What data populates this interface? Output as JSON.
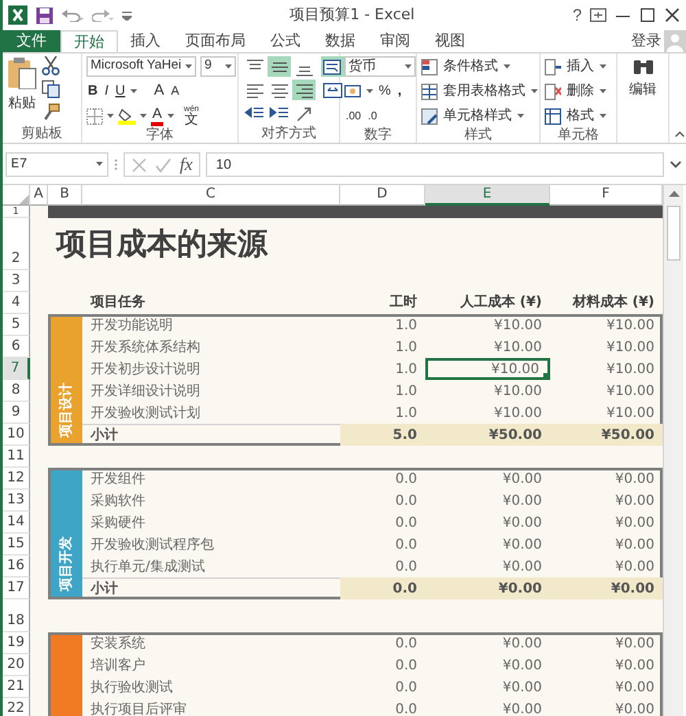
{
  "window": {
    "title": "项目预算1 - Excel",
    "help": "?"
  },
  "ribbon_tabs": [
    {
      "label": "文件",
      "kind": "file",
      "selected": false
    },
    {
      "label": "开始",
      "kind": "tab",
      "selected": true
    },
    {
      "label": "插入",
      "kind": "tab",
      "selected": false
    },
    {
      "label": "页面布局",
      "kind": "tab",
      "selected": false
    },
    {
      "label": "公式",
      "kind": "tab",
      "selected": false
    },
    {
      "label": "数据",
      "kind": "tab",
      "selected": false
    },
    {
      "label": "审阅",
      "kind": "tab",
      "selected": false
    },
    {
      "label": "视图",
      "kind": "tab",
      "selected": false
    }
  ],
  "account": "登录",
  "ribbon": {
    "clipboard": {
      "label": "剪贴板",
      "paste": "粘贴"
    },
    "font": {
      "label": "字体",
      "font_name": "Microsoft YaHei",
      "font_size": "9",
      "bold": "B",
      "italic": "I",
      "underline": "U",
      "grow": "A",
      "shrink": "A",
      "font_color": "A",
      "phonetic": "wén",
      "phonetic_char": "文"
    },
    "alignment": {
      "label": "对齐方式",
      "rows": [
        [
          {
            "kind": "top",
            "selected": false
          },
          {
            "kind": "middle",
            "selected": true
          },
          {
            "kind": "bottom",
            "selected": false
          },
          {
            "kind": "wrap",
            "selected": true
          }
        ],
        [
          {
            "kind": "left",
            "selected": false
          },
          {
            "kind": "center",
            "selected": false
          },
          {
            "kind": "right",
            "selected": true
          },
          {
            "kind": "merge",
            "selected": false
          }
        ],
        [
          {
            "kind": "outdent",
            "selected": false
          },
          {
            "kind": "indent",
            "selected": false
          },
          {
            "kind": "orientation",
            "selected": false
          }
        ]
      ]
    },
    "number": {
      "label": "数字",
      "format": "货币",
      "percent": "%",
      "comma": ",",
      "increase_decimal": ".00",
      "decrease_decimal": ".0"
    },
    "styles": {
      "label": "样式",
      "buttons": [
        {
          "kind": "conditional",
          "label": "条件格式"
        },
        {
          "kind": "table",
          "label": "套用表格格式"
        },
        {
          "kind": "cell",
          "label": "单元格样式"
        }
      ]
    },
    "cells": {
      "label": "单元格",
      "buttons": [
        {
          "kind": "insert",
          "label": "插入"
        },
        {
          "kind": "delete",
          "label": "删除"
        },
        {
          "kind": "format",
          "label": "格式"
        }
      ]
    },
    "editing": {
      "label": "编辑"
    }
  },
  "formula_bar": {
    "name_box": "E7",
    "function_label": "fx",
    "value": "10"
  },
  "columns": [
    {
      "label": "A",
      "selected": false
    },
    {
      "label": "B",
      "selected": false
    },
    {
      "label": "C",
      "selected": false
    },
    {
      "label": "D",
      "selected": false
    },
    {
      "label": "E",
      "selected": true
    },
    {
      "label": "F",
      "selected": false
    }
  ],
  "rows": [
    {
      "label": "1",
      "selected": false
    },
    {
      "label": "2",
      "selected": false
    },
    {
      "label": "3",
      "selected": false
    },
    {
      "label": "4",
      "selected": false
    },
    {
      "label": "5",
      "selected": false
    },
    {
      "label": "6",
      "selected": false
    },
    {
      "label": "7",
      "selected": true
    },
    {
      "label": "8",
      "selected": false
    },
    {
      "label": "9",
      "selected": false
    },
    {
      "label": "10",
      "selected": false
    },
    {
      "label": "11",
      "selected": false
    },
    {
      "label": "12",
      "selected": false
    },
    {
      "label": "13",
      "selected": false
    },
    {
      "label": "14",
      "selected": false
    },
    {
      "label": "15",
      "selected": false
    },
    {
      "label": "16",
      "selected": false
    },
    {
      "label": "17",
      "selected": false
    },
    {
      "label": "18",
      "selected": false
    },
    {
      "label": "19",
      "selected": false
    },
    {
      "label": "20",
      "selected": false
    },
    {
      "label": "21",
      "selected": false
    },
    {
      "label": "22",
      "selected": false
    }
  ],
  "sheet": {
    "title": "项目成本的来源",
    "headers": [
      "项目任务",
      "工时",
      "人工成本 (¥)",
      "材料成本 (¥)"
    ],
    "groups": [
      {
        "label": "项目设计",
        "color": "#e9a22d",
        "tasks": [
          {
            "name": "开发功能说明",
            "hours": "1.0",
            "labor": "¥10.00",
            "material": "¥10.00",
            "selected": false
          },
          {
            "name": "开发系统体系结构",
            "hours": "1.0",
            "labor": "¥10.00",
            "material": "¥10.00",
            "selected": false
          },
          {
            "name": "开发初步设计说明",
            "hours": "1.0",
            "labor": "¥10.00",
            "material": "¥10.00",
            "selected": true
          },
          {
            "name": "开发详细设计说明",
            "hours": "1.0",
            "labor": "¥10.00",
            "material": "¥10.00",
            "selected": false
          },
          {
            "name": "开发验收测试计划",
            "hours": "1.0",
            "labor": "¥10.00",
            "material": "¥10.00",
            "selected": false
          }
        ],
        "subtotal": {
          "label": "小计",
          "hours": "5.0",
          "labor": "¥50.00",
          "material": "¥50.00"
        }
      },
      {
        "label": "项目开发",
        "color": "#3ea5c6",
        "tasks": [
          {
            "name": "开发组件",
            "hours": "0.0",
            "labor": "¥0.00",
            "material": "¥0.00",
            "selected": false
          },
          {
            "name": "采购软件",
            "hours": "0.0",
            "labor": "¥0.00",
            "material": "¥0.00",
            "selected": false
          },
          {
            "name": "采购硬件",
            "hours": "0.0",
            "labor": "¥0.00",
            "material": "¥0.00",
            "selected": false
          },
          {
            "name": "开发验收测试程序包",
            "hours": "0.0",
            "labor": "¥0.00",
            "material": "¥0.00",
            "selected": false
          },
          {
            "name": "执行单元/集成测试",
            "hours": "0.0",
            "labor": "¥0.00",
            "material": "¥0.00",
            "selected": false
          }
        ],
        "subtotal": {
          "label": "小计",
          "hours": "0.0",
          "labor": "¥0.00",
          "material": "¥0.00"
        }
      },
      {
        "color": "#f07b24",
        "tasks": [
          {
            "name": "安装系统",
            "hours": "0.0",
            "labor": "¥0.00",
            "material": "¥0.00",
            "selected": false
          },
          {
            "name": "培训客户",
            "hours": "0.0",
            "labor": "¥0.00",
            "material": "¥0.00",
            "selected": false
          },
          {
            "name": "执行验收测试",
            "hours": "0.0",
            "labor": "¥0.00",
            "material": "¥0.00",
            "selected": false
          },
          {
            "name": "执行项目后评审",
            "hours": "0.0",
            "labor": "¥0.00",
            "material": "¥0.00",
            "selected": false
          }
        ]
      }
    ]
  }
}
